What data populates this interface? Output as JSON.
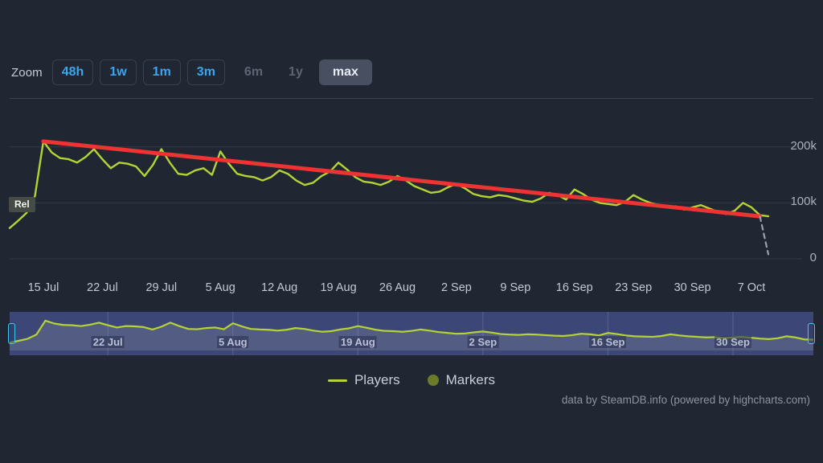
{
  "range_selector": {
    "label": "Zoom",
    "buttons": [
      {
        "label": "48h",
        "state": "enabled"
      },
      {
        "label": "1w",
        "state": "enabled"
      },
      {
        "label": "1m",
        "state": "enabled"
      },
      {
        "label": "3m",
        "state": "enabled"
      },
      {
        "label": "6m",
        "state": "disabled"
      },
      {
        "label": "1y",
        "state": "disabled"
      },
      {
        "label": "max",
        "state": "selected"
      }
    ]
  },
  "annotations": {
    "release_marker": "Rel"
  },
  "legend": {
    "items": [
      {
        "label": "Players",
        "color": "#b5d334",
        "marker": "line"
      },
      {
        "label": "Markers",
        "color": "#6b7a2b",
        "marker": "dot"
      }
    ]
  },
  "credits": {
    "text": "data by SteamDB.info (powered by highcharts.com)"
  },
  "navigator": {
    "xlabels": [
      "22 Jul",
      "5 Aug",
      "19 Aug",
      "2 Sep",
      "16 Sep",
      "30 Sep"
    ],
    "selection_start_pct": 0,
    "selection_end_pct": 100,
    "series_color": "#b5d334",
    "mask_color": "#4a59a6"
  },
  "colors": {
    "background": "#212732",
    "players_line": "#b5d334",
    "trend_line": "#ee3333",
    "projection_line": "#9aa0ac",
    "accent_blue": "#3ba5f0",
    "gridline": "#333a48",
    "axis_text": "#c3c9d4"
  },
  "chart_data": {
    "type": "line",
    "title": "",
    "subtitle": "",
    "xlabel": "",
    "ylabel": "",
    "grid": true,
    "legend_position": "bottom",
    "ylim": [
      0,
      250000
    ],
    "yticks": [
      0,
      100000,
      200000
    ],
    "ytick_labels": [
      "0",
      "100k",
      "200k"
    ],
    "xticks": [
      "15 Jul",
      "22 Jul",
      "29 Jul",
      "5 Aug",
      "12 Aug",
      "19 Aug",
      "26 Aug",
      "2 Sep",
      "9 Sep",
      "16 Sep",
      "23 Sep",
      "30 Sep",
      "7 Oct"
    ],
    "x_start": "11 Jul",
    "x_end": "9 Oct",
    "series": [
      {
        "name": "Players",
        "color": "#b5d334",
        "type": "line",
        "x": [
          "11 Jul",
          "12 Jul",
          "13 Jul",
          "14 Jul",
          "15 Jul",
          "16 Jul",
          "17 Jul",
          "18 Jul",
          "19 Jul",
          "20 Jul",
          "21 Jul",
          "22 Jul",
          "23 Jul",
          "24 Jul",
          "25 Jul",
          "26 Jul",
          "27 Jul",
          "28 Jul",
          "29 Jul",
          "30 Jul",
          "31 Jul",
          "1 Aug",
          "2 Aug",
          "3 Aug",
          "4 Aug",
          "5 Aug",
          "6 Aug",
          "7 Aug",
          "8 Aug",
          "9 Aug",
          "10 Aug",
          "11 Aug",
          "12 Aug",
          "13 Aug",
          "14 Aug",
          "15 Aug",
          "16 Aug",
          "17 Aug",
          "18 Aug",
          "19 Aug",
          "20 Aug",
          "21 Aug",
          "22 Aug",
          "23 Aug",
          "24 Aug",
          "25 Aug",
          "26 Aug",
          "27 Aug",
          "28 Aug",
          "29 Aug",
          "30 Aug",
          "31 Aug",
          "1 Sep",
          "2 Sep",
          "3 Sep",
          "4 Sep",
          "5 Sep",
          "6 Sep",
          "7 Sep",
          "8 Sep",
          "9 Sep",
          "10 Sep",
          "11 Sep",
          "12 Sep",
          "13 Sep",
          "14 Sep",
          "15 Sep",
          "16 Sep",
          "17 Sep",
          "18 Sep",
          "19 Sep",
          "20 Sep",
          "21 Sep",
          "22 Sep",
          "23 Sep",
          "24 Sep",
          "25 Sep",
          "26 Sep",
          "27 Sep",
          "28 Sep",
          "29 Sep",
          "30 Sep",
          "1 Oct",
          "2 Oct",
          "3 Oct",
          "4 Oct",
          "5 Oct",
          "6 Oct",
          "7 Oct",
          "8 Oct",
          "9 Oct"
        ],
        "values": [
          55000,
          68000,
          82000,
          112000,
          210000,
          190000,
          180000,
          178000,
          172000,
          182000,
          196000,
          178000,
          162000,
          172000,
          170000,
          165000,
          148000,
          168000,
          196000,
          172000,
          152000,
          150000,
          158000,
          162000,
          150000,
          192000,
          170000,
          152000,
          148000,
          146000,
          140000,
          146000,
          158000,
          152000,
          140000,
          132000,
          136000,
          148000,
          156000,
          172000,
          160000,
          146000,
          138000,
          136000,
          132000,
          138000,
          148000,
          140000,
          130000,
          124000,
          118000,
          120000,
          128000,
          134000,
          126000,
          116000,
          112000,
          110000,
          114000,
          112000,
          108000,
          104000,
          102000,
          108000,
          118000,
          114000,
          106000,
          124000,
          116000,
          106000,
          100000,
          98000,
          96000,
          102000,
          114000,
          106000,
          100000,
          96000,
          92000,
          94000,
          88000,
          92000,
          96000,
          90000,
          84000,
          80000,
          86000,
          100000,
          92000,
          78000,
          76000
        ]
      },
      {
        "name": "Trend",
        "color": "#ee3333",
        "type": "trendline",
        "x_start": "15 Jul",
        "x_end": "8 Oct",
        "y_start": 210000,
        "y_end": 76000
      },
      {
        "name": "Projection",
        "color": "#9aa0ac",
        "type": "dashed",
        "x_start": "8 Oct",
        "x_end": "9 Oct",
        "y_start": 76000,
        "y_end": 8000
      }
    ]
  }
}
